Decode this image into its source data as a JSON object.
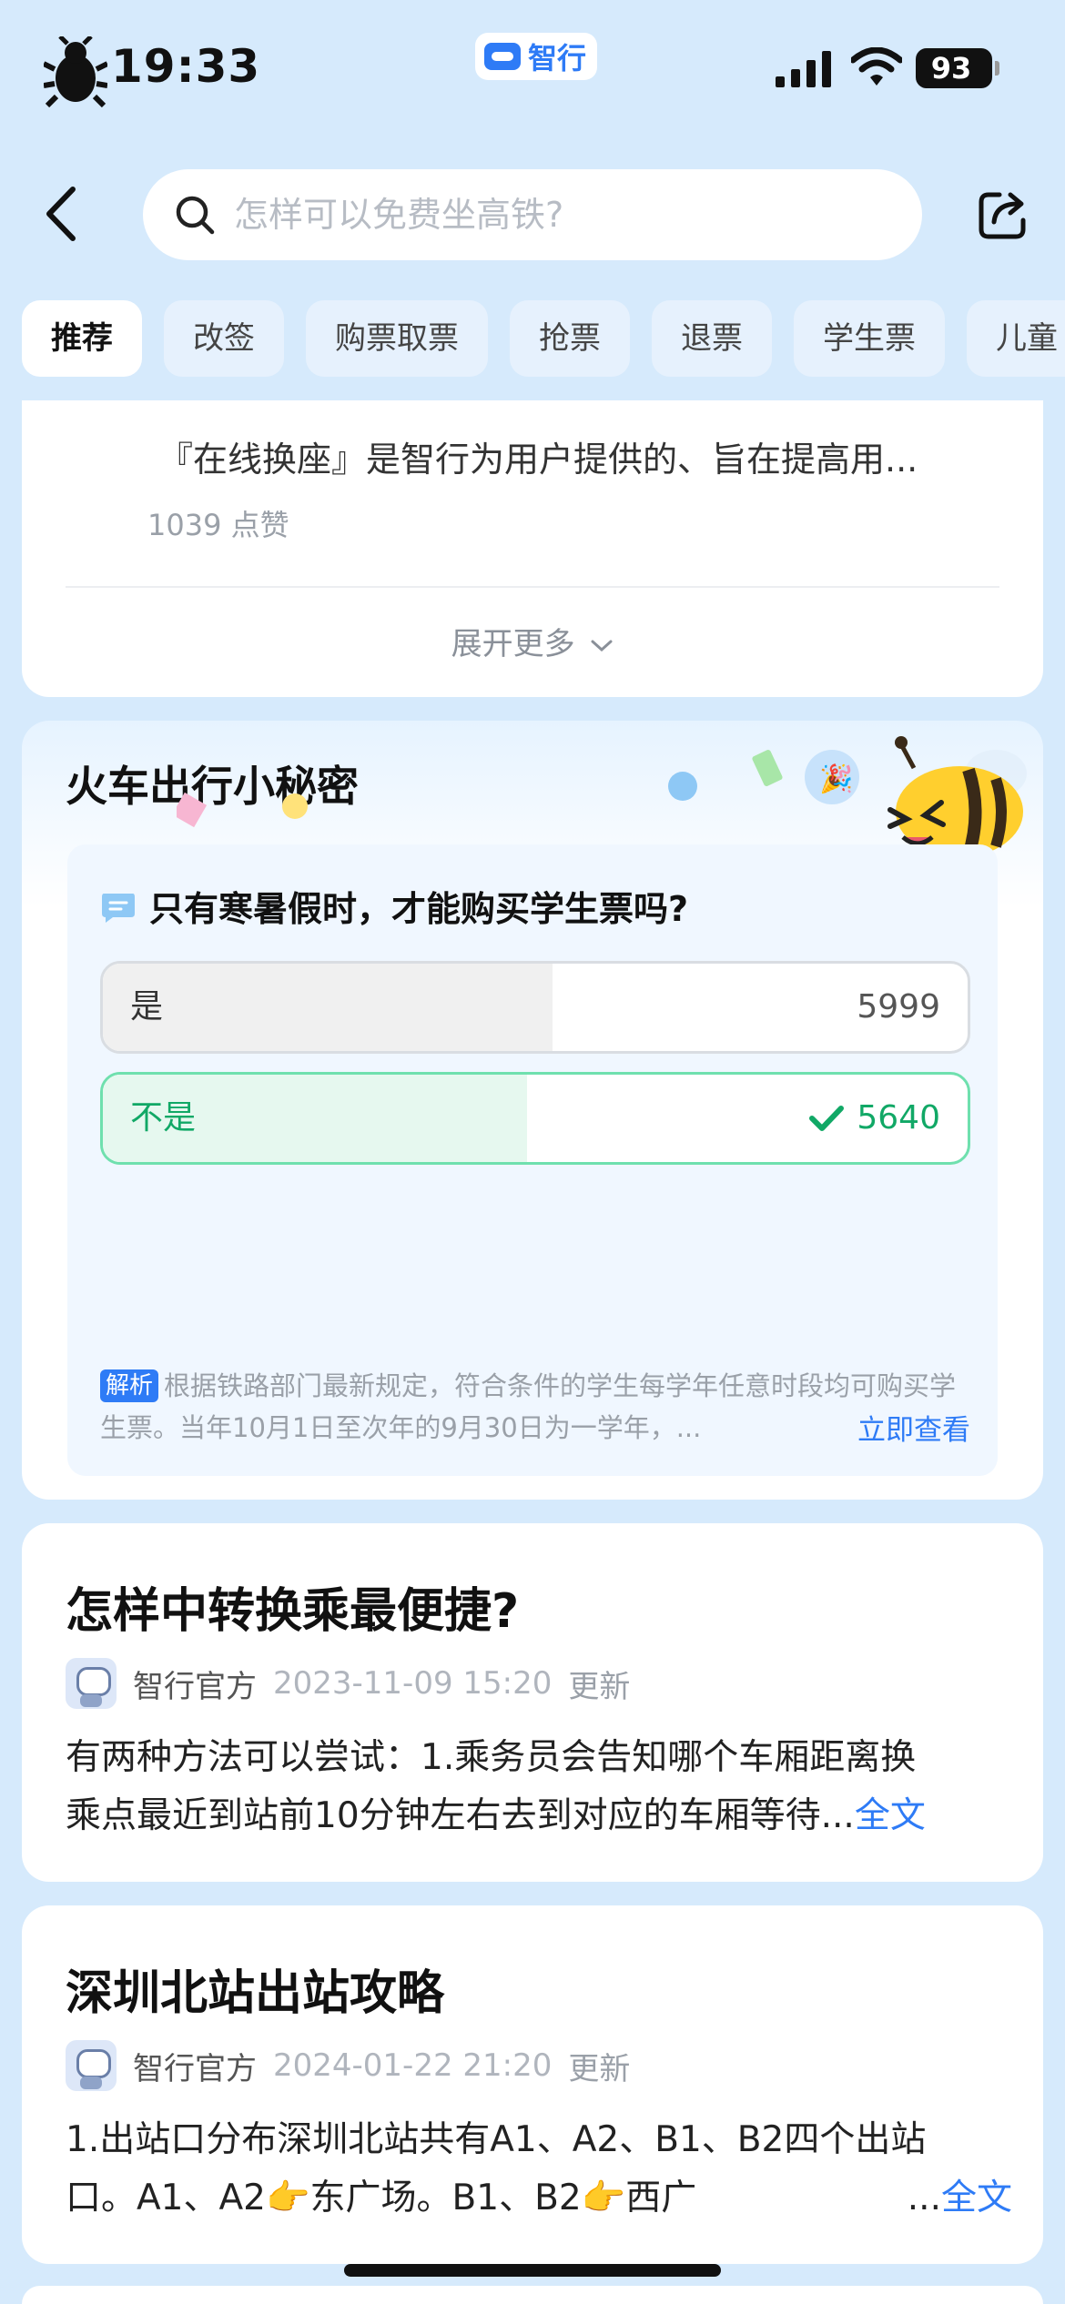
{
  "status_bar": {
    "time": "19:33",
    "app_pill": "智行",
    "battery": "93"
  },
  "nav": {
    "search_placeholder": "怎样可以免费坐高铁?"
  },
  "tabs": [
    "推荐",
    "改签",
    "购票取票",
    "抢票",
    "退票",
    "学生票",
    "儿童"
  ],
  "top_card": {
    "text": "『在线换座』是智行为用户提供的、旨在提高用...",
    "likes": "1039 点赞",
    "expand_more": "展开更多"
  },
  "quiz": {
    "title": "火车出行小秘密",
    "question": "只有寒暑假时，才能购买学生票吗?",
    "options": [
      {
        "label": "是",
        "count": "5999",
        "fill": 0.52,
        "correct": false
      },
      {
        "label": "不是",
        "count": "5640",
        "fill": 0.49,
        "correct": true
      }
    ],
    "analysis_tag": "解析",
    "analysis_text": "根据铁路部门最新规定，符合条件的学生每学年任意时段均可购买学生票。当年10月1日至次年的9月30日为一学年，...",
    "view_now": "立即查看"
  },
  "articles": [
    {
      "title": "怎样中转换乘最便捷?",
      "author": "智行官方",
      "time": "2023-11-09 15:20",
      "update": "更新",
      "line1": "有两种方法可以尝试：1.乘务员会告知哪个车厢距离换",
      "line2": "乘点最近到站前10分钟左右去到对应的车厢等待...",
      "more": "全文"
    },
    {
      "title": "深圳北站出站攻略",
      "author": "智行官方",
      "time": "2024-01-22 21:20",
      "update": "更新",
      "line1": "1.出站口分布深圳北站共有A1、A2、B1、B2四个出站",
      "line2": "口。A1、A2👉东广场。B1、B2👉西广",
      "ellipsis": "...",
      "more": "全文"
    }
  ],
  "colors": {
    "background": "#d6eafc",
    "accent": "#2e7bf6",
    "correct": "#11a866"
  }
}
